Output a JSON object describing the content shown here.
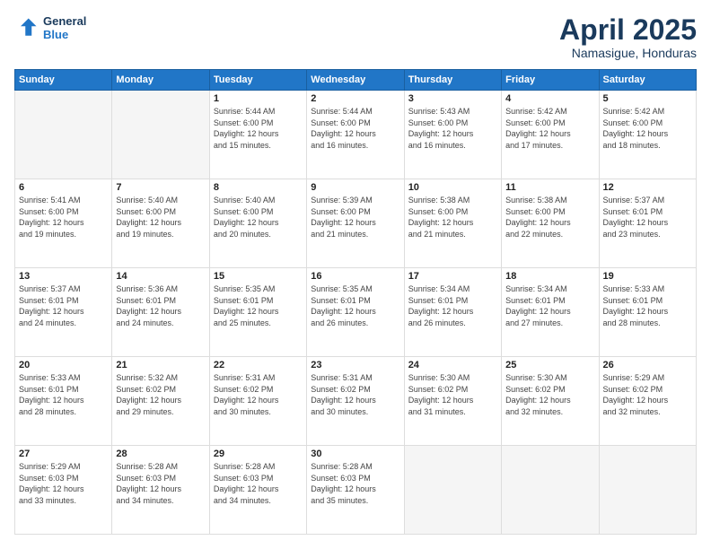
{
  "header": {
    "logo_line1": "General",
    "logo_line2": "Blue",
    "month": "April 2025",
    "location": "Namasigue, Honduras"
  },
  "weekdays": [
    "Sunday",
    "Monday",
    "Tuesday",
    "Wednesday",
    "Thursday",
    "Friday",
    "Saturday"
  ],
  "weeks": [
    [
      {
        "day": "",
        "info": ""
      },
      {
        "day": "",
        "info": ""
      },
      {
        "day": "1",
        "info": "Sunrise: 5:44 AM\nSunset: 6:00 PM\nDaylight: 12 hours\nand 15 minutes."
      },
      {
        "day": "2",
        "info": "Sunrise: 5:44 AM\nSunset: 6:00 PM\nDaylight: 12 hours\nand 16 minutes."
      },
      {
        "day": "3",
        "info": "Sunrise: 5:43 AM\nSunset: 6:00 PM\nDaylight: 12 hours\nand 16 minutes."
      },
      {
        "day": "4",
        "info": "Sunrise: 5:42 AM\nSunset: 6:00 PM\nDaylight: 12 hours\nand 17 minutes."
      },
      {
        "day": "5",
        "info": "Sunrise: 5:42 AM\nSunset: 6:00 PM\nDaylight: 12 hours\nand 18 minutes."
      }
    ],
    [
      {
        "day": "6",
        "info": "Sunrise: 5:41 AM\nSunset: 6:00 PM\nDaylight: 12 hours\nand 19 minutes."
      },
      {
        "day": "7",
        "info": "Sunrise: 5:40 AM\nSunset: 6:00 PM\nDaylight: 12 hours\nand 19 minutes."
      },
      {
        "day": "8",
        "info": "Sunrise: 5:40 AM\nSunset: 6:00 PM\nDaylight: 12 hours\nand 20 minutes."
      },
      {
        "day": "9",
        "info": "Sunrise: 5:39 AM\nSunset: 6:00 PM\nDaylight: 12 hours\nand 21 minutes."
      },
      {
        "day": "10",
        "info": "Sunrise: 5:38 AM\nSunset: 6:00 PM\nDaylight: 12 hours\nand 21 minutes."
      },
      {
        "day": "11",
        "info": "Sunrise: 5:38 AM\nSunset: 6:00 PM\nDaylight: 12 hours\nand 22 minutes."
      },
      {
        "day": "12",
        "info": "Sunrise: 5:37 AM\nSunset: 6:01 PM\nDaylight: 12 hours\nand 23 minutes."
      }
    ],
    [
      {
        "day": "13",
        "info": "Sunrise: 5:37 AM\nSunset: 6:01 PM\nDaylight: 12 hours\nand 24 minutes."
      },
      {
        "day": "14",
        "info": "Sunrise: 5:36 AM\nSunset: 6:01 PM\nDaylight: 12 hours\nand 24 minutes."
      },
      {
        "day": "15",
        "info": "Sunrise: 5:35 AM\nSunset: 6:01 PM\nDaylight: 12 hours\nand 25 minutes."
      },
      {
        "day": "16",
        "info": "Sunrise: 5:35 AM\nSunset: 6:01 PM\nDaylight: 12 hours\nand 26 minutes."
      },
      {
        "day": "17",
        "info": "Sunrise: 5:34 AM\nSunset: 6:01 PM\nDaylight: 12 hours\nand 26 minutes."
      },
      {
        "day": "18",
        "info": "Sunrise: 5:34 AM\nSunset: 6:01 PM\nDaylight: 12 hours\nand 27 minutes."
      },
      {
        "day": "19",
        "info": "Sunrise: 5:33 AM\nSunset: 6:01 PM\nDaylight: 12 hours\nand 28 minutes."
      }
    ],
    [
      {
        "day": "20",
        "info": "Sunrise: 5:33 AM\nSunset: 6:01 PM\nDaylight: 12 hours\nand 28 minutes."
      },
      {
        "day": "21",
        "info": "Sunrise: 5:32 AM\nSunset: 6:02 PM\nDaylight: 12 hours\nand 29 minutes."
      },
      {
        "day": "22",
        "info": "Sunrise: 5:31 AM\nSunset: 6:02 PM\nDaylight: 12 hours\nand 30 minutes."
      },
      {
        "day": "23",
        "info": "Sunrise: 5:31 AM\nSunset: 6:02 PM\nDaylight: 12 hours\nand 30 minutes."
      },
      {
        "day": "24",
        "info": "Sunrise: 5:30 AM\nSunset: 6:02 PM\nDaylight: 12 hours\nand 31 minutes."
      },
      {
        "day": "25",
        "info": "Sunrise: 5:30 AM\nSunset: 6:02 PM\nDaylight: 12 hours\nand 32 minutes."
      },
      {
        "day": "26",
        "info": "Sunrise: 5:29 AM\nSunset: 6:02 PM\nDaylight: 12 hours\nand 32 minutes."
      }
    ],
    [
      {
        "day": "27",
        "info": "Sunrise: 5:29 AM\nSunset: 6:03 PM\nDaylight: 12 hours\nand 33 minutes."
      },
      {
        "day": "28",
        "info": "Sunrise: 5:28 AM\nSunset: 6:03 PM\nDaylight: 12 hours\nand 34 minutes."
      },
      {
        "day": "29",
        "info": "Sunrise: 5:28 AM\nSunset: 6:03 PM\nDaylight: 12 hours\nand 34 minutes."
      },
      {
        "day": "30",
        "info": "Sunrise: 5:28 AM\nSunset: 6:03 PM\nDaylight: 12 hours\nand 35 minutes."
      },
      {
        "day": "",
        "info": ""
      },
      {
        "day": "",
        "info": ""
      },
      {
        "day": "",
        "info": ""
      }
    ]
  ]
}
